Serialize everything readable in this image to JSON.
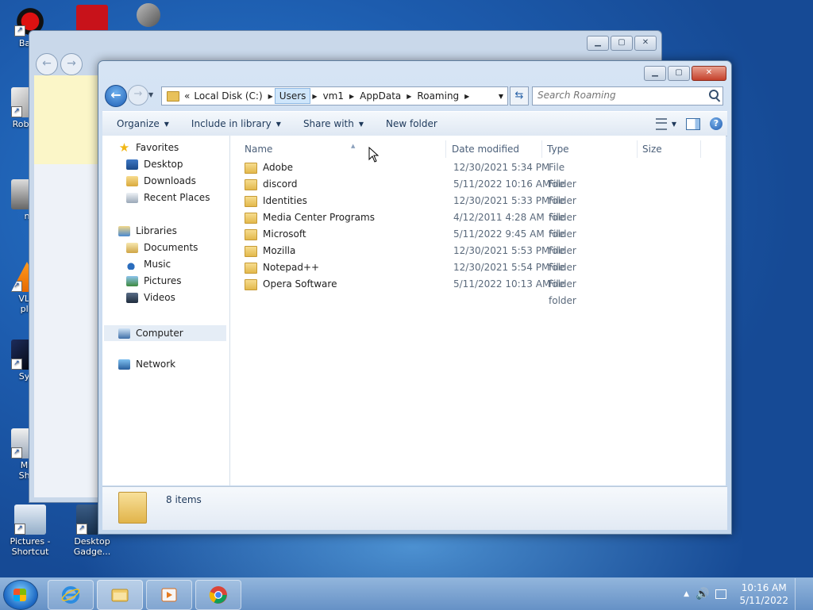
{
  "desktop": {
    "icons": [
      {
        "label": "Band"
      },
      {
        "label": "Roblox"
      },
      {
        "label": "n"
      },
      {
        "label": "VLC"
      },
      {
        "label": "pla"
      },
      {
        "label": "Syn"
      },
      {
        "label": "Mu"
      },
      {
        "label": "Sho"
      },
      {
        "label": "Pictures - Shortcut"
      },
      {
        "label": "Desktop Gadge..."
      }
    ]
  },
  "explorer": {
    "address": {
      "overflow": "«",
      "crumbs": [
        "Local Disk (C:)",
        "Users",
        "vm1",
        "AppData",
        "Roaming"
      ]
    },
    "search_placeholder": "Search Roaming",
    "toolbar": {
      "organize": "Organize",
      "include_in_library": "Include in library",
      "share_with": "Share with",
      "new_folder": "New folder"
    },
    "nav": {
      "favorites": "Favorites",
      "desktop": "Desktop",
      "downloads": "Downloads",
      "recent_places": "Recent Places",
      "libraries": "Libraries",
      "documents": "Documents",
      "music": "Music",
      "pictures": "Pictures",
      "videos": "Videos",
      "computer": "Computer",
      "network": "Network"
    },
    "columns": {
      "name": "Name",
      "date_modified": "Date modified",
      "type": "Type",
      "size": "Size"
    },
    "files": [
      {
        "name": "Adobe",
        "date": "12/30/2021 5:34 PM",
        "type": "File folder"
      },
      {
        "name": "discord",
        "date": "5/11/2022 10:16 AM",
        "type": "File folder"
      },
      {
        "name": "Identities",
        "date": "12/30/2021 5:33 PM",
        "type": "File folder"
      },
      {
        "name": "Media Center Programs",
        "date": "4/12/2011 4:28 AM",
        "type": "File folder"
      },
      {
        "name": "Microsoft",
        "date": "5/11/2022 9:45 AM",
        "type": "File folder"
      },
      {
        "name": "Mozilla",
        "date": "12/30/2021 5:53 PM",
        "type": "File folder"
      },
      {
        "name": "Notepad++",
        "date": "12/30/2021 5:54 PM",
        "type": "File folder"
      },
      {
        "name": "Opera Software",
        "date": "5/11/2022 10:13 AM",
        "type": "File folder"
      }
    ],
    "details": {
      "count": "8 items"
    }
  },
  "taskbar": {
    "clock_time": "10:16 AM",
    "clock_date": "5/11/2022",
    "apps": [
      "internet-explorer",
      "windows-explorer",
      "media-player",
      "chrome"
    ]
  }
}
